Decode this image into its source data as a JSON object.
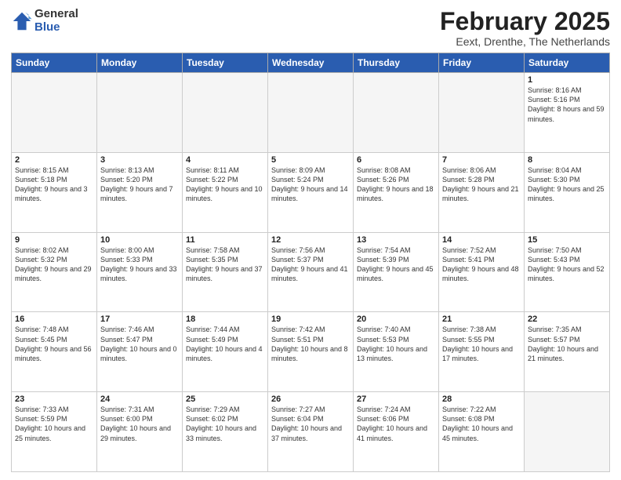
{
  "logo": {
    "general": "General",
    "blue": "Blue"
  },
  "header": {
    "month": "February 2025",
    "location": "Eext, Drenthe, The Netherlands"
  },
  "weekdays": [
    "Sunday",
    "Monday",
    "Tuesday",
    "Wednesday",
    "Thursday",
    "Friday",
    "Saturday"
  ],
  "weeks": [
    [
      {
        "day": "",
        "info": ""
      },
      {
        "day": "",
        "info": ""
      },
      {
        "day": "",
        "info": ""
      },
      {
        "day": "",
        "info": ""
      },
      {
        "day": "",
        "info": ""
      },
      {
        "day": "",
        "info": ""
      },
      {
        "day": "1",
        "info": "Sunrise: 8:16 AM\nSunset: 5:16 PM\nDaylight: 8 hours and 59 minutes."
      }
    ],
    [
      {
        "day": "2",
        "info": "Sunrise: 8:15 AM\nSunset: 5:18 PM\nDaylight: 9 hours and 3 minutes."
      },
      {
        "day": "3",
        "info": "Sunrise: 8:13 AM\nSunset: 5:20 PM\nDaylight: 9 hours and 7 minutes."
      },
      {
        "day": "4",
        "info": "Sunrise: 8:11 AM\nSunset: 5:22 PM\nDaylight: 9 hours and 10 minutes."
      },
      {
        "day": "5",
        "info": "Sunrise: 8:09 AM\nSunset: 5:24 PM\nDaylight: 9 hours and 14 minutes."
      },
      {
        "day": "6",
        "info": "Sunrise: 8:08 AM\nSunset: 5:26 PM\nDaylight: 9 hours and 18 minutes."
      },
      {
        "day": "7",
        "info": "Sunrise: 8:06 AM\nSunset: 5:28 PM\nDaylight: 9 hours and 21 minutes."
      },
      {
        "day": "8",
        "info": "Sunrise: 8:04 AM\nSunset: 5:30 PM\nDaylight: 9 hours and 25 minutes."
      }
    ],
    [
      {
        "day": "9",
        "info": "Sunrise: 8:02 AM\nSunset: 5:32 PM\nDaylight: 9 hours and 29 minutes."
      },
      {
        "day": "10",
        "info": "Sunrise: 8:00 AM\nSunset: 5:33 PM\nDaylight: 9 hours and 33 minutes."
      },
      {
        "day": "11",
        "info": "Sunrise: 7:58 AM\nSunset: 5:35 PM\nDaylight: 9 hours and 37 minutes."
      },
      {
        "day": "12",
        "info": "Sunrise: 7:56 AM\nSunset: 5:37 PM\nDaylight: 9 hours and 41 minutes."
      },
      {
        "day": "13",
        "info": "Sunrise: 7:54 AM\nSunset: 5:39 PM\nDaylight: 9 hours and 45 minutes."
      },
      {
        "day": "14",
        "info": "Sunrise: 7:52 AM\nSunset: 5:41 PM\nDaylight: 9 hours and 48 minutes."
      },
      {
        "day": "15",
        "info": "Sunrise: 7:50 AM\nSunset: 5:43 PM\nDaylight: 9 hours and 52 minutes."
      }
    ],
    [
      {
        "day": "16",
        "info": "Sunrise: 7:48 AM\nSunset: 5:45 PM\nDaylight: 9 hours and 56 minutes."
      },
      {
        "day": "17",
        "info": "Sunrise: 7:46 AM\nSunset: 5:47 PM\nDaylight: 10 hours and 0 minutes."
      },
      {
        "day": "18",
        "info": "Sunrise: 7:44 AM\nSunset: 5:49 PM\nDaylight: 10 hours and 4 minutes."
      },
      {
        "day": "19",
        "info": "Sunrise: 7:42 AM\nSunset: 5:51 PM\nDaylight: 10 hours and 8 minutes."
      },
      {
        "day": "20",
        "info": "Sunrise: 7:40 AM\nSunset: 5:53 PM\nDaylight: 10 hours and 13 minutes."
      },
      {
        "day": "21",
        "info": "Sunrise: 7:38 AM\nSunset: 5:55 PM\nDaylight: 10 hours and 17 minutes."
      },
      {
        "day": "22",
        "info": "Sunrise: 7:35 AM\nSunset: 5:57 PM\nDaylight: 10 hours and 21 minutes."
      }
    ],
    [
      {
        "day": "23",
        "info": "Sunrise: 7:33 AM\nSunset: 5:59 PM\nDaylight: 10 hours and 25 minutes."
      },
      {
        "day": "24",
        "info": "Sunrise: 7:31 AM\nSunset: 6:00 PM\nDaylight: 10 hours and 29 minutes."
      },
      {
        "day": "25",
        "info": "Sunrise: 7:29 AM\nSunset: 6:02 PM\nDaylight: 10 hours and 33 minutes."
      },
      {
        "day": "26",
        "info": "Sunrise: 7:27 AM\nSunset: 6:04 PM\nDaylight: 10 hours and 37 minutes."
      },
      {
        "day": "27",
        "info": "Sunrise: 7:24 AM\nSunset: 6:06 PM\nDaylight: 10 hours and 41 minutes."
      },
      {
        "day": "28",
        "info": "Sunrise: 7:22 AM\nSunset: 6:08 PM\nDaylight: 10 hours and 45 minutes."
      },
      {
        "day": "",
        "info": ""
      }
    ]
  ]
}
